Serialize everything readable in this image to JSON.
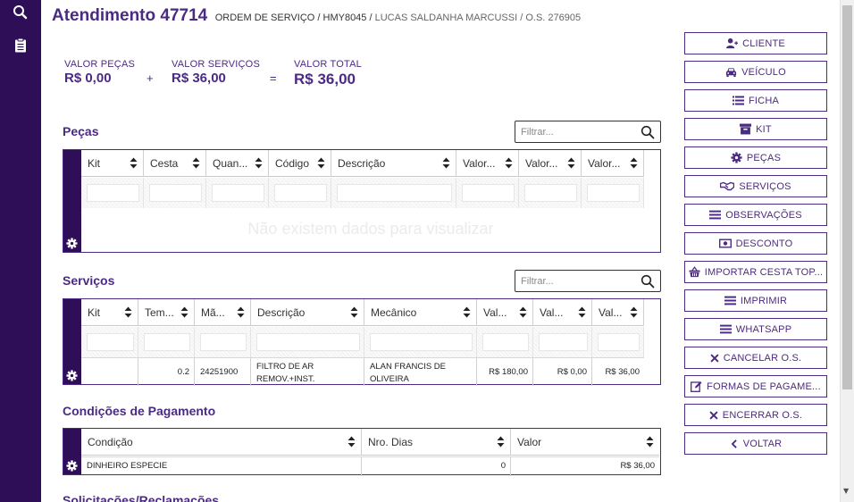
{
  "header": {
    "title": "Atendimento 47714",
    "subtitle_main": "ORDEM DE SERVIÇO / HMY8045 /",
    "subtitle_client": "LUCAS SALDANHA MARCUSSI",
    "subtitle_os": "/ O.S. 276905"
  },
  "totals": {
    "pecas_label": "VALOR PEÇAS",
    "pecas_value": "R$ 0,00",
    "plus": "+",
    "servicos_label": "VALOR SERVIÇOS",
    "servicos_value": "R$ 36,00",
    "equals": "=",
    "total_label": "VALOR TOTAL",
    "total_value": "R$ 36,00"
  },
  "pecas": {
    "title": "Peças",
    "filter_placeholder": "Filtrar...",
    "columns": [
      "Kit",
      "Cesta",
      "Quan...",
      "Código",
      "Descrição",
      "Valor...",
      "Valor...",
      "Valor..."
    ],
    "empty_message": "Não existem dados para visualizar"
  },
  "servicos": {
    "title": "Serviços",
    "filter_placeholder": "Filtrar...",
    "columns": [
      "Kit",
      "Tem...",
      "Mã...",
      "Descrição",
      "Mecânico",
      "Val...",
      "Val...",
      "Val..."
    ],
    "rows": [
      [
        "",
        "0.2",
        "24251900",
        "FILTRO DE AR REMOV.+INST.",
        "ALAN FRANCIS DE OLIVEIRA",
        "R$ 180,00",
        "R$ 0,00",
        "R$ 36,00"
      ]
    ]
  },
  "condicoes": {
    "title": "Condições de Pagamento",
    "columns": [
      "Condição",
      "Nro. Dias",
      "Valor"
    ],
    "rows": [
      [
        "DINHEIRO ESPECIE",
        "0",
        "R$ 36,00"
      ]
    ]
  },
  "next_section_title": "Solicitações/Reclamações",
  "actions": {
    "cliente": "CLIENTE",
    "veiculo": "VEÍCULO",
    "ficha": "FICHA",
    "kit": "KIT",
    "pecas": "PEÇAS",
    "servicos": "SERVIÇOS",
    "observacoes": "OBSERVAÇÕES",
    "desconto": "DESCONTO",
    "importar": "IMPORTAR CESTA TOP...",
    "imprimir": "IMPRIMIR",
    "whatsapp": "WHATSAPP",
    "cancelar": "CANCELAR O.S.",
    "formas": "FORMAS DE PAGAME...",
    "encerrar": "ENCERRAR O.S.",
    "voltar": "VOLTAR"
  },
  "colors": {
    "brand": "#4b2a85",
    "sidebar": "#2e0e57"
  }
}
